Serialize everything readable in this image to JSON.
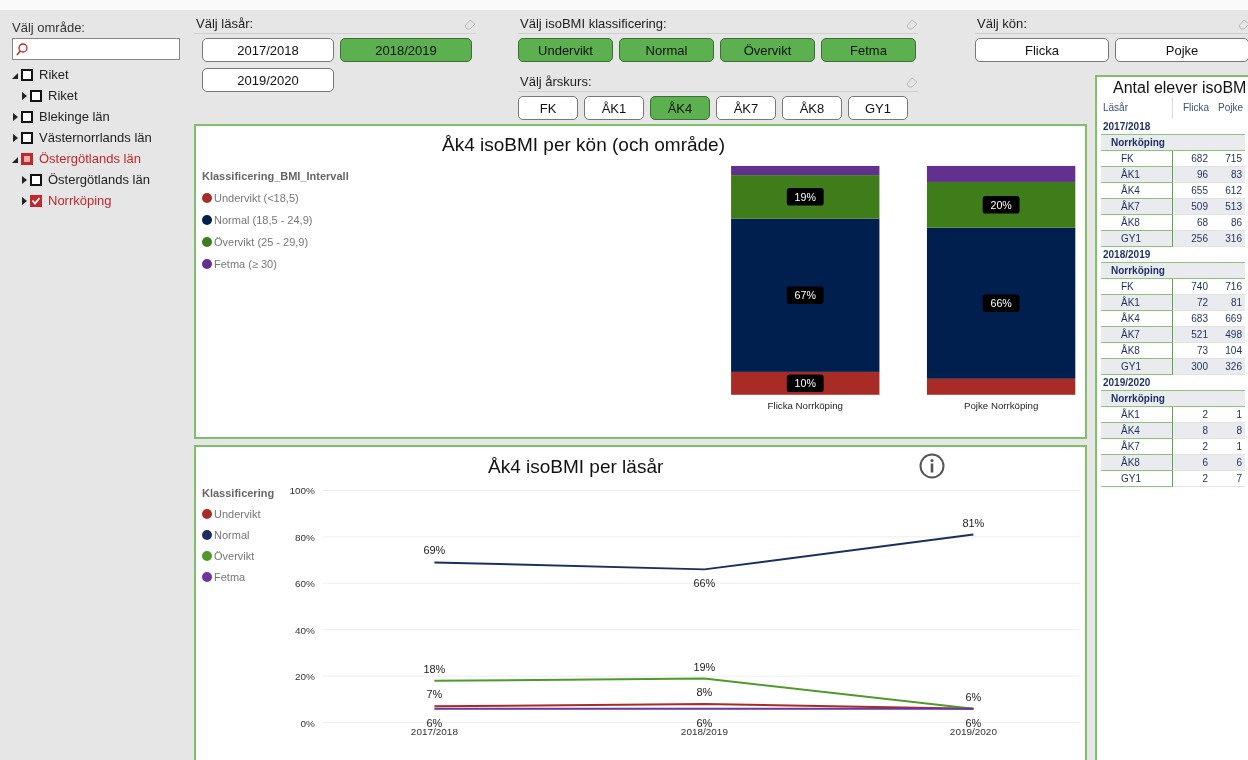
{
  "sidebar": {
    "label": "Välj område:",
    "tree": [
      {
        "label": "Riket",
        "expanded": true,
        "checked": false,
        "partial": false,
        "children": [
          {
            "label": "Riket",
            "expanded": false,
            "checked": false,
            "partial": false
          }
        ]
      },
      {
        "label": "Blekinge län",
        "expanded": false,
        "checked": false,
        "partial": false
      },
      {
        "label": "Västernorrlands län",
        "expanded": false,
        "checked": false,
        "partial": false
      },
      {
        "label": "Östergötlands län",
        "expanded": true,
        "checked": false,
        "partial": true,
        "children": [
          {
            "label": "Östergötlands län",
            "expanded": false,
            "checked": false,
            "partial": false
          },
          {
            "label": "Norrköping",
            "expanded": false,
            "checked": true
          }
        ]
      }
    ]
  },
  "filters": {
    "school_year": {
      "label": "Välj läsår:",
      "options": [
        {
          "label": "2017/2018",
          "selected": false
        },
        {
          "label": "2018/2019",
          "selected": true
        },
        {
          "label": "2019/2020",
          "selected": false
        }
      ]
    },
    "classification": {
      "label": "Välj isoBMI klassificering:",
      "options": [
        {
          "label": "Undervikt",
          "selected": true
        },
        {
          "label": "Normal",
          "selected": true
        },
        {
          "label": "Övervikt",
          "selected": true
        },
        {
          "label": "Fetma",
          "selected": true
        }
      ]
    },
    "grade": {
      "label": "Välj årskurs:",
      "options": [
        {
          "label": "FK",
          "selected": false
        },
        {
          "label": "ÅK1",
          "selected": false
        },
        {
          "label": "ÅK4",
          "selected": true
        },
        {
          "label": "ÅK7",
          "selected": false
        },
        {
          "label": "ÅK8",
          "selected": false
        },
        {
          "label": "GY1",
          "selected": false
        }
      ]
    },
    "gender": {
      "label": "Välj kön:",
      "options": [
        {
          "label": "Flicka",
          "selected": false
        },
        {
          "label": "Pojke",
          "selected": false
        }
      ]
    }
  },
  "gender_chart": {
    "legend_title": "Klassificering_BMI_Intervall",
    "chart_data": {
      "type": "bar",
      "stacked": true,
      "title": "Åk4 isoBMI per kön (och område)",
      "categories": [
        "Flicka Norrköping",
        "Pojke Norrköping"
      ],
      "series": [
        {
          "name": "Undervikt (<18,5)",
          "color": "#a82c25",
          "values": [
            10,
            7
          ],
          "value_labels": [
            "10%",
            null
          ]
        },
        {
          "name": "Normal (18,5 - 24,9)",
          "color": "#001f4f",
          "values": [
            67,
            66
          ],
          "value_labels": [
            "67%",
            "66%"
          ]
        },
        {
          "name": "Övervikt (25 - 29,9)",
          "color": "#3f7d1b",
          "values": [
            19,
            20
          ],
          "value_labels": [
            "19%",
            "20%"
          ]
        },
        {
          "name": "Fetma (≥ 30)",
          "color": "#62308f",
          "values": [
            4,
            7
          ],
          "value_labels": [
            null,
            null
          ]
        }
      ]
    }
  },
  "year_chart": {
    "legend_title": "Klassificering",
    "chart_data": {
      "type": "line",
      "title": "Åk4 isoBMI per läsår",
      "categories": [
        "2017/2018",
        "2018/2019",
        "2019/2020"
      ],
      "grid": true,
      "ylim": [
        0,
        100
      ],
      "yticks": [
        {
          "value": 0,
          "label": "0%"
        },
        {
          "value": 20,
          "label": "20%"
        },
        {
          "value": 40,
          "label": "40%"
        },
        {
          "value": 60,
          "label": "60%"
        },
        {
          "value": 80,
          "label": "80%"
        },
        {
          "value": 100,
          "label": "100%"
        }
      ],
      "series": [
        {
          "name": "Undervikt",
          "color": "#a82c25",
          "values": [
            7,
            8,
            6
          ],
          "value_labels": [
            "7%",
            "8%",
            "6%"
          ]
        },
        {
          "name": "Normal",
          "color": "#1b2f5e",
          "values": [
            69,
            66,
            81
          ],
          "value_labels": [
            "69%",
            "66%",
            "81%"
          ]
        },
        {
          "name": "Övervikt",
          "color": "#4e9a2a",
          "values": [
            18,
            19,
            6
          ],
          "value_labels": [
            "18%",
            "19%",
            null
          ]
        },
        {
          "name": "Fetma",
          "color": "#6a35a0",
          "values": [
            6,
            6,
            6
          ],
          "value_labels": [
            "6%",
            "6%",
            "6%"
          ]
        }
      ]
    }
  },
  "table": {
    "title": "Antal elever isoBM",
    "columns": [
      "Läsår",
      "Flicka",
      "Pojke"
    ],
    "rows": [
      {
        "kind": "year",
        "cells": [
          "2017/2018"
        ]
      },
      {
        "kind": "area",
        "cells": [
          "Norrköping"
        ]
      },
      {
        "kind": "grade",
        "cells": [
          "FK",
          "682",
          "715"
        ]
      },
      {
        "kind": "grade",
        "cells": [
          "ÅK1",
          "96",
          "83"
        ]
      },
      {
        "kind": "grade",
        "cells": [
          "ÅK4",
          "655",
          "612"
        ]
      },
      {
        "kind": "grade",
        "cells": [
          "ÅK7",
          "509",
          "513"
        ]
      },
      {
        "kind": "grade",
        "cells": [
          "ÅK8",
          "68",
          "86"
        ]
      },
      {
        "kind": "grade",
        "cells": [
          "GY1",
          "256",
          "316"
        ]
      },
      {
        "kind": "year",
        "cells": [
          "2018/2019"
        ]
      },
      {
        "kind": "area",
        "cells": [
          "Norrköping"
        ]
      },
      {
        "kind": "grade",
        "cells": [
          "FK",
          "740",
          "716"
        ]
      },
      {
        "kind": "grade",
        "cells": [
          "ÅK1",
          "72",
          "81"
        ]
      },
      {
        "kind": "grade",
        "cells": [
          "ÅK4",
          "683",
          "669"
        ]
      },
      {
        "kind": "grade",
        "cells": [
          "ÅK7",
          "521",
          "498"
        ]
      },
      {
        "kind": "grade",
        "cells": [
          "ÅK8",
          "73",
          "104"
        ]
      },
      {
        "kind": "grade",
        "cells": [
          "GY1",
          "300",
          "326"
        ]
      },
      {
        "kind": "year",
        "cells": [
          "2019/2020"
        ]
      },
      {
        "kind": "area",
        "cells": [
          "Norrköping"
        ]
      },
      {
        "kind": "grade",
        "cells": [
          "ÅK1",
          "2",
          "1"
        ]
      },
      {
        "kind": "grade",
        "cells": [
          "ÅK4",
          "8",
          "8"
        ]
      },
      {
        "kind": "grade",
        "cells": [
          "ÅK7",
          "2",
          "1"
        ]
      },
      {
        "kind": "grade",
        "cells": [
          "ÅK8",
          "6",
          "6"
        ]
      },
      {
        "kind": "grade",
        "cells": [
          "GY1",
          "2",
          "7"
        ]
      }
    ]
  }
}
